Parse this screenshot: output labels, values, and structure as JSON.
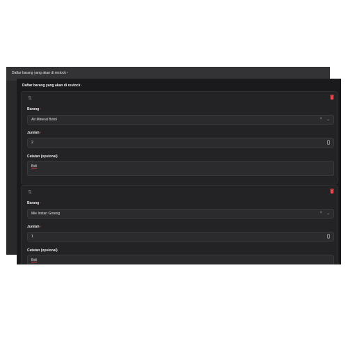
{
  "background_panel": {
    "title": "Daftar barang yang akan di restock",
    "required_mark": "*"
  },
  "panel": {
    "title": "Daftar barang yang akan di restock",
    "required_mark": "*"
  },
  "items": [
    {
      "barang_label": "Barang",
      "barang_value": "Air Mineral Botol",
      "jumlah_label": "Jumlah",
      "jumlah_value": "2",
      "catatan_label": "Catatan (opsional)",
      "catatan_value": "Beli"
    },
    {
      "barang_label": "Barang",
      "barang_value": "Mie Instan Goreng",
      "jumlah_label": "Jumlah",
      "jumlah_value": "1",
      "catatan_label": "Catatan (opsional)",
      "catatan_value": "Beli"
    }
  ],
  "icons": {
    "drag": "drag-handle-icon",
    "delete": "trash-icon",
    "clear": "clear-icon",
    "chevron": "chevron-down-icon",
    "stepper": "number-stepper-icon"
  },
  "colors": {
    "panel_bg": "#1a1a1c",
    "card_bg": "#232325",
    "input_bg": "#2b2b2e",
    "danger": "#e5484d"
  }
}
